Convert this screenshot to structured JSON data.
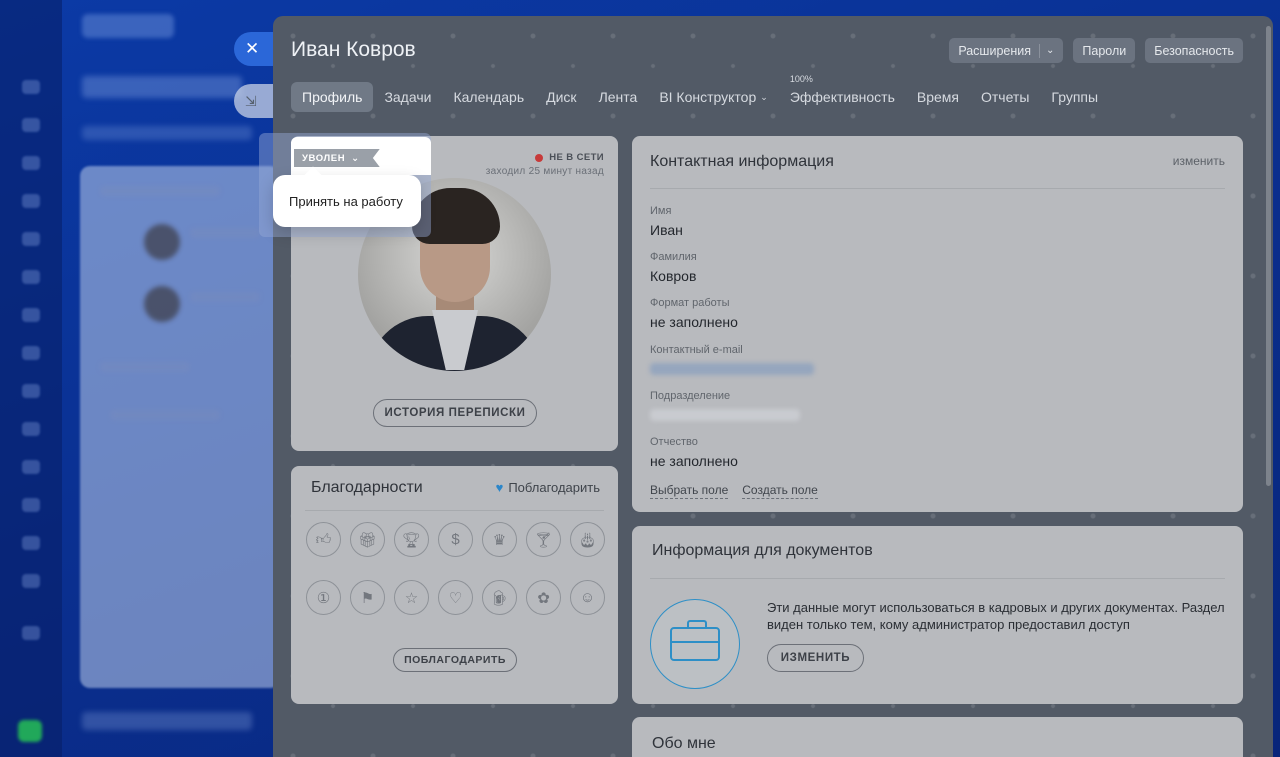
{
  "slider": {
    "user_name": "Иван Ковров",
    "header_buttons": {
      "extensions": "Расширения",
      "passwords": "Пароли",
      "security": "Безопасность"
    },
    "tabs": [
      {
        "label": "Профиль",
        "active": true
      },
      {
        "label": "Задачи"
      },
      {
        "label": "Календарь"
      },
      {
        "label": "Диск"
      },
      {
        "label": "Лента"
      },
      {
        "label": "BI Конструктор"
      },
      {
        "label": "Эффективность",
        "badge": "100%"
      },
      {
        "label": "Время"
      },
      {
        "label": "Отчеты"
      },
      {
        "label": "Группы"
      }
    ]
  },
  "profile": {
    "status_ribbon": "УВОЛЕН",
    "status_menu_item": "Принять на работу",
    "online_status": "НЕ В СЕТИ",
    "online_status_color": "#c73a3a",
    "last_seen": "заходил 25 минут назад",
    "history_button": "ИСТОРИЯ ПЕРЕПИСКИ"
  },
  "thanks": {
    "title": "Благодарности",
    "thank_link": "Поблагодарить",
    "thank_button": "ПОБЛАГОДАРИТЬ",
    "badge_icons": [
      "thumbs-up-icon",
      "gift-icon",
      "trophy-icon",
      "money-bag-icon",
      "crown-icon",
      "cocktail-icon",
      "cake-icon",
      "number-one-icon",
      "flag-icon",
      "star-icon",
      "heart-icon",
      "beer-icon",
      "flower-icon",
      "smile-icon"
    ]
  },
  "contact": {
    "title": "Контактная информация",
    "edit_link": "изменить",
    "fields": [
      {
        "label": "Имя",
        "value": "Иван"
      },
      {
        "label": "Фамилия",
        "value": "Ковров"
      },
      {
        "label": "Формат работы",
        "value": "не заполнено"
      },
      {
        "label": "Контактный e-mail",
        "value": ""
      },
      {
        "label": "Подразделение",
        "value": ""
      },
      {
        "label": "Отчество",
        "value": "не заполнено"
      }
    ],
    "choose_field": "Выбрать поле",
    "create_field": "Создать поле"
  },
  "docs": {
    "title": "Информация для документов",
    "text": "Эти данные могут использоваться в кадровых и других документах. Раздел виден только тем, кому администратор предоставил доступ",
    "button": "ИЗМЕНИТЬ",
    "accent_color": "#2d8fc7"
  },
  "about": {
    "title": "Обо мне"
  }
}
